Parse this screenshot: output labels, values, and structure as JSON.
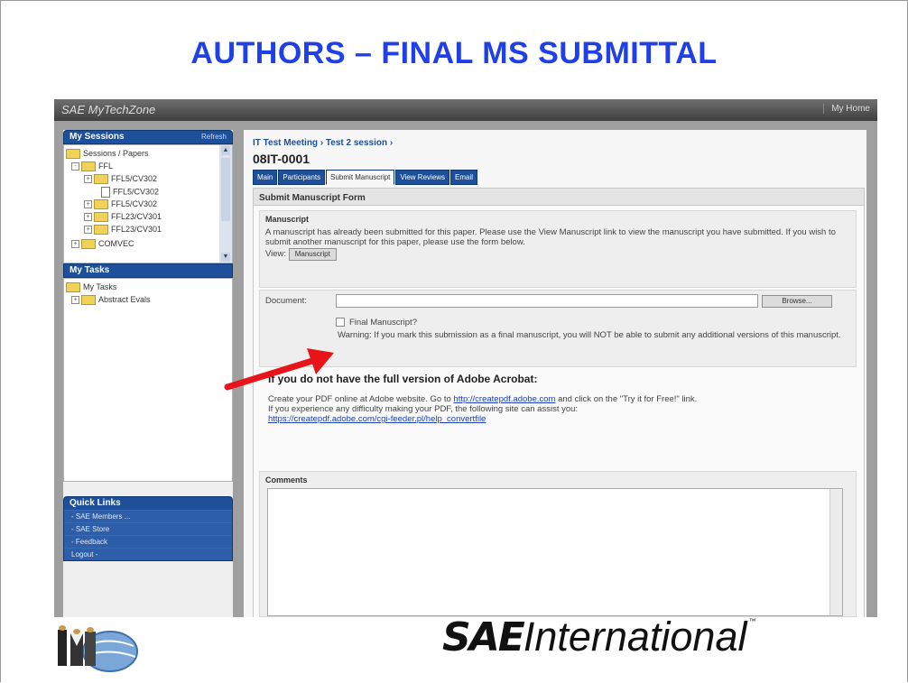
{
  "slide": {
    "title": "AUTHORS – FINAL MS SUBMITTAL"
  },
  "app": {
    "brand": "SAE MyTechZone",
    "home_link": "My Home"
  },
  "sidebar": {
    "sessions_header": "My Sessions",
    "refresh_label": "Refresh",
    "session_tree": [
      {
        "label": "Sessions / Papers",
        "type": "folder"
      },
      {
        "label": "FFL",
        "type": "folder",
        "toggle": "-"
      },
      {
        "label": "FFL5/CV302",
        "type": "folder",
        "toggle": "+"
      },
      {
        "label": "FFL5/CV302",
        "type": "doc"
      },
      {
        "label": "FFL5/CV302",
        "type": "folder",
        "toggle": "+"
      },
      {
        "label": "FFL23/CV301",
        "type": "folder",
        "toggle": "+"
      },
      {
        "label": "FFL23/CV301",
        "type": "folder",
        "toggle": "+"
      },
      {
        "label": "COMVEC",
        "type": "folder",
        "toggle": "+"
      }
    ],
    "tasks_header": "My Tasks",
    "task_tree": [
      {
        "label": "My Tasks",
        "type": "folder"
      },
      {
        "label": "Abstract Evals",
        "type": "folder",
        "toggle": "+"
      }
    ],
    "quick_links_header": "Quick Links",
    "quick_links": [
      "- SAE Members ...",
      "- SAE Store",
      "- Feedback",
      "Logout -"
    ]
  },
  "main": {
    "breadcrumb": "IT Test Meeting  ›  Test 2 session  ›",
    "paper_id": "08IT-0001",
    "tabs": [
      {
        "label": "Main",
        "active": false
      },
      {
        "label": "Participants",
        "active": false
      },
      {
        "label": "Submit Manuscript",
        "active": true
      },
      {
        "label": "View Reviews",
        "active": false
      },
      {
        "label": "Email",
        "active": false
      }
    ],
    "form_title": "Submit Manuscript Form",
    "manuscript_heading": "Manuscript",
    "manuscript_note": "A manuscript has already been submitted for this paper. Please use the View Manuscript link to view the manuscript you have submitted. If you wish to submit another manuscript for this paper, please use the form below.",
    "view_label": "View:",
    "view_button": "Manuscript",
    "document_label": "Document:",
    "document_value": "",
    "browse_button": "Browse...",
    "final_checkbox_label": "Final Manuscript?",
    "final_checkbox_checked": false,
    "warning_text": "Warning: If you mark this submission as a final manuscript, you will NOT be able to submit any additional versions of this manuscript.",
    "acrobat_heading": "If you do not have the full version of Adobe Acrobat:",
    "acrobat_text_1": "Create your PDF online at Adobe website. Go to",
    "acrobat_link_1": "http://createpdf.adobe.com",
    "acrobat_text_2": "and click on the \"Try it for Free!\" link.",
    "acrobat_text_3": "If you experience any difficulty making your PDF, the following site can assist you:",
    "acrobat_link_2": "https://createpdf.adobe.com/cgi-feeder.pl/help_convertfile",
    "comments_heading": "Comments",
    "comments_value": ""
  },
  "footer": {
    "logo_left": "IMO",
    "logo_right_sae": "SAE",
    "logo_right_intl": "International",
    "logo_right_tm": "™"
  },
  "colors": {
    "title_blue": "#1f3fe8",
    "nav_blue": "#1d4f9a",
    "arrow_red": "#e8141a"
  }
}
